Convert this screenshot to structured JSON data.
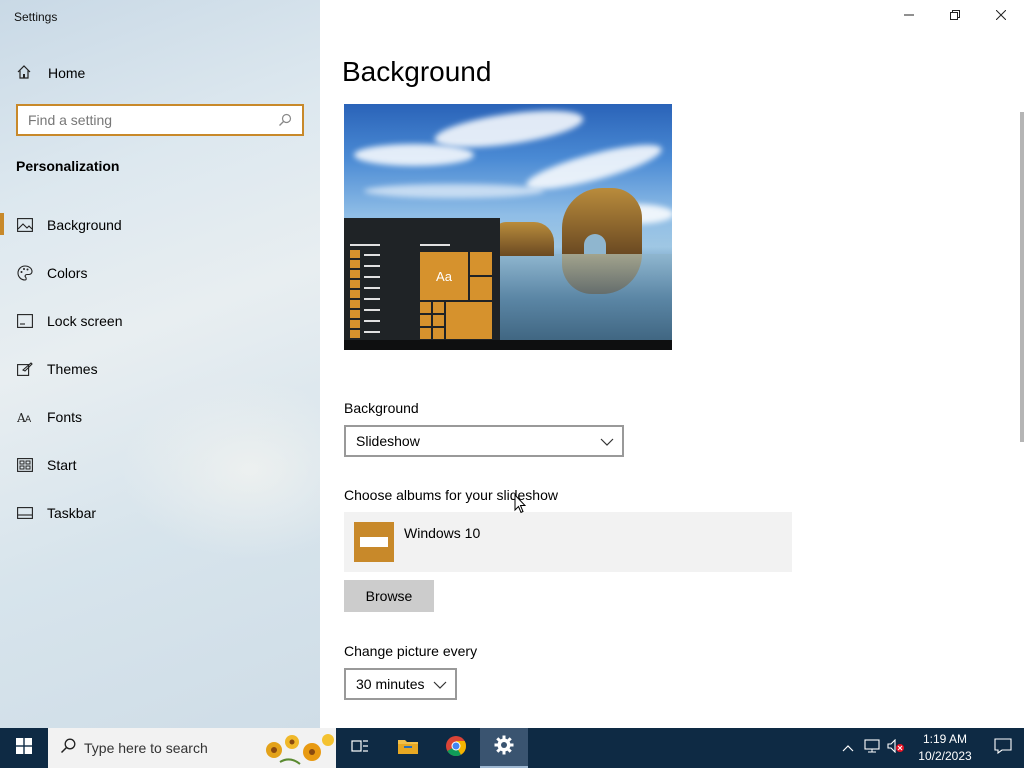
{
  "window": {
    "title": "Settings"
  },
  "sidebar": {
    "home_label": "Home",
    "search_placeholder": "Find a setting",
    "section_title": "Personalization",
    "items": [
      {
        "label": "Background",
        "icon": "picture-icon",
        "active": true
      },
      {
        "label": "Colors",
        "icon": "palette-icon"
      },
      {
        "label": "Lock screen",
        "icon": "lock-screen-icon"
      },
      {
        "label": "Themes",
        "icon": "themes-icon"
      },
      {
        "label": "Fonts",
        "icon": "fonts-icon"
      },
      {
        "label": "Start",
        "icon": "start-icon"
      },
      {
        "label": "Taskbar",
        "icon": "taskbar-icon"
      }
    ]
  },
  "main": {
    "page_title": "Background",
    "preview_tile_text": "Aa",
    "background_label": "Background",
    "background_value": "Slideshow",
    "albums_label": "Choose albums for your slideshow",
    "album_name": "Windows 10",
    "browse_label": "Browse",
    "interval_label": "Change picture every",
    "interval_value": "30 minutes"
  },
  "taskbar": {
    "search_placeholder": "Type here to search",
    "time": "1:19 AM",
    "date": "10/2/2023"
  },
  "colors": {
    "accent": "#c8892a",
    "taskbar": "#0e2a44"
  }
}
